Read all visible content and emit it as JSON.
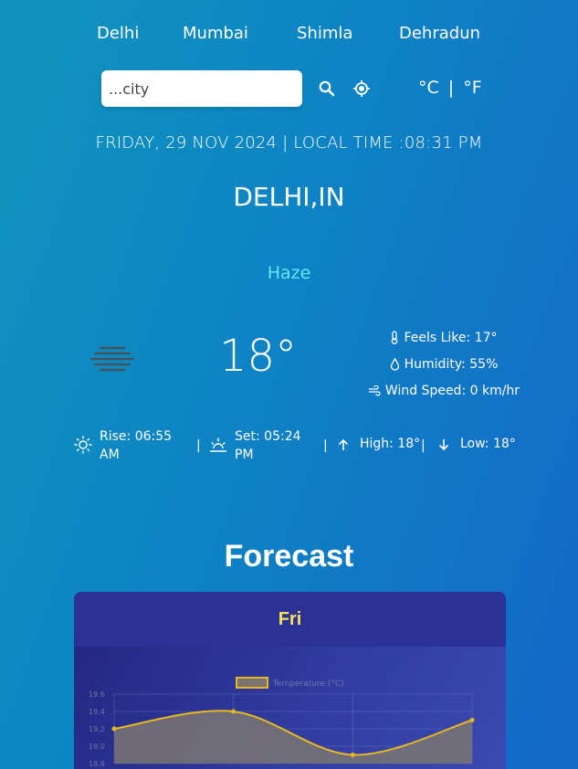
{
  "cities": [
    "Delhi",
    "Mumbai",
    "Shimla",
    "Dehradun"
  ],
  "search": {
    "placeholder": "...city"
  },
  "units": {
    "celsius": "°C",
    "separator": "|",
    "fahrenheit": "°F"
  },
  "datetime": "FRIDAY, 29 NOV 2024 | LOCAL TIME :08:31 PM",
  "location": "DELHI,IN",
  "condition": "Haze",
  "temperature": "18°",
  "details": {
    "feels_like": "Feels Like: 17°",
    "humidity": "Humidity: 55%",
    "wind_speed": "Wind Speed: 0 km/hr"
  },
  "sun": {
    "rise": "Rise: 06:55 AM",
    "set": "Set: 05:24 PM",
    "high": "High: 18°",
    "low": "Low: 18°",
    "separator": "|"
  },
  "forecast": {
    "title": "Forecast",
    "day": "Fri"
  },
  "colors": {
    "accent_condition": "#67e2f5",
    "forecast_day": "#f5e25a",
    "line": "#e8b820",
    "fill": "#7a7572"
  },
  "chart_data": {
    "type": "area",
    "legend": "Temperature (°C)",
    "y_ticks": [
      "19.6",
      "19.4",
      "19.2",
      "19.0",
      "18.8"
    ],
    "ylim": [
      18.8,
      19.6
    ],
    "x": [
      0,
      1,
      2,
      3
    ],
    "values": [
      19.2,
      19.4,
      18.9,
      19.3
    ],
    "series": [
      {
        "name": "Temperature (°C)",
        "values": [
          19.2,
          19.4,
          18.9,
          19.3
        ]
      }
    ]
  }
}
